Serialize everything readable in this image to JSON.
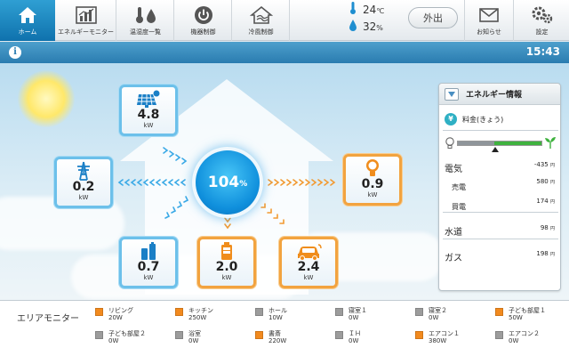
{
  "nav": {
    "items": [
      {
        "label": "ホーム",
        "icon": "home-icon"
      },
      {
        "label": "エネルギーモニター",
        "icon": "bar-chart-icon"
      },
      {
        "label": "温湿度一覧",
        "icon": "thermometer-droplet-icon"
      },
      {
        "label": "機器制御",
        "icon": "power-icon"
      },
      {
        "label": "冷風制御",
        "icon": "house-fan-icon"
      }
    ],
    "temperature": {
      "value": "24",
      "unit": "℃",
      "icon": "thermometer-icon"
    },
    "humidity": {
      "value": "32",
      "unit": "%",
      "icon": "droplet-icon"
    },
    "away_button": "外出",
    "notice": {
      "label": "お知らせ",
      "icon": "envelope-icon"
    },
    "settings": {
      "label": "設定",
      "icon": "gears-icon"
    }
  },
  "infobar": {
    "time": "15:43",
    "icon": "info-icon"
  },
  "energy_flow": {
    "solar": {
      "value": "4.8",
      "unit": "kW",
      "icon": "solar-panel-icon"
    },
    "grid": {
      "value": "0.2",
      "unit": "kW",
      "icon": "power-tower-icon"
    },
    "battery": {
      "value": "0.7",
      "unit": "kW",
      "icon": "storage-battery-icon"
    },
    "charger": {
      "value": "2.0",
      "unit": "kW",
      "icon": "battery-charge-icon"
    },
    "ev": {
      "value": "2.4",
      "unit": "kW",
      "icon": "electric-car-icon"
    },
    "house_load": {
      "value": "0.9",
      "unit": "kW",
      "icon": "light-bulb-icon"
    },
    "center": {
      "value": "104",
      "unit": "%"
    }
  },
  "energy_panel": {
    "title": "エネルギー情報",
    "rate_label": "料金(きょう)",
    "rows": {
      "electricity": {
        "label": "電気",
        "value": "-435",
        "unit": "円"
      },
      "generation": {
        "label": "売電",
        "value": "580",
        "unit": "円"
      },
      "purchase": {
        "label": "買電",
        "value": "174",
        "unit": "円"
      },
      "water": {
        "label": "水道",
        "value": "98",
        "unit": "円"
      },
      "gas": {
        "label": "ガス",
        "value": "198",
        "unit": "円"
      }
    },
    "eco_level": 0.55,
    "colors": {
      "eco_green": "#3fb23f",
      "eco_gray": "#8f959a"
    }
  },
  "area_monitor": {
    "title": "エリアモニター",
    "items": [
      {
        "name": "リビング",
        "watts": "20W",
        "color": "#f28a1e"
      },
      {
        "name": "キッチン",
        "watts": "250W",
        "color": "#f28a1e"
      },
      {
        "name": "ホール",
        "watts": "10W",
        "color": "#9c9c9c"
      },
      {
        "name": "寝室１",
        "watts": "0W",
        "color": "#9c9c9c"
      },
      {
        "name": "寝室２",
        "watts": "0W",
        "color": "#9c9c9c"
      },
      {
        "name": "子ども部屋１",
        "watts": "50W",
        "color": "#f28a1e"
      },
      {
        "name": "子ども部屋２",
        "watts": "0W",
        "color": "#9c9c9c"
      },
      {
        "name": "浴室",
        "watts": "0W",
        "color": "#9c9c9c"
      },
      {
        "name": "書斎",
        "watts": "220W",
        "color": "#f28a1e"
      },
      {
        "name": "ＩＨ",
        "watts": "0W",
        "color": "#9c9c9c"
      },
      {
        "name": "エアコン１",
        "watts": "380W",
        "color": "#f28a1e"
      },
      {
        "name": "エアコン２",
        "watts": "0W",
        "color": "#9c9c9c"
      }
    ]
  }
}
